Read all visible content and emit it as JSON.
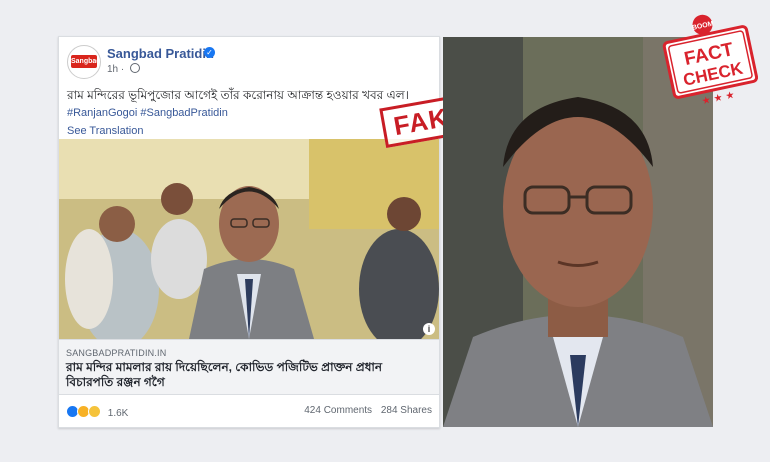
{
  "post": {
    "page_name": "Sangbad Pratidin",
    "avatar_logo_text": "Sangbad",
    "time": "1h",
    "caption": "রাম মন্দিরের ভূমিপুজোর আগেই তাঁর করোনায় আক্রান্ত হওয়ার খবর এল।",
    "hashtags": "#RanjanGogoi #SangbadPratidin",
    "see_translation": "See Translation",
    "link_domain": "SANGBADPRATIDIN.IN",
    "link_title": "রাম মন্দির মামলার রায় দিয়েছিলেন, কোভিড পজিটিভ প্রাক্তন প্রধান বিচারপতি রঞ্জন গগৈ",
    "reaction_count": "1.6K",
    "comments": "424 Comments",
    "shares": "284 Shares",
    "info_icon": "i"
  },
  "stamp": {
    "fake_label": "FAKE"
  },
  "badge": {
    "top": "BOOM",
    "line1": "FACT",
    "line2": "CHECK"
  },
  "colors": {
    "facebook_blue": "#385898",
    "stamp_red": "#c81d25",
    "badge_red": "#d9232d"
  }
}
